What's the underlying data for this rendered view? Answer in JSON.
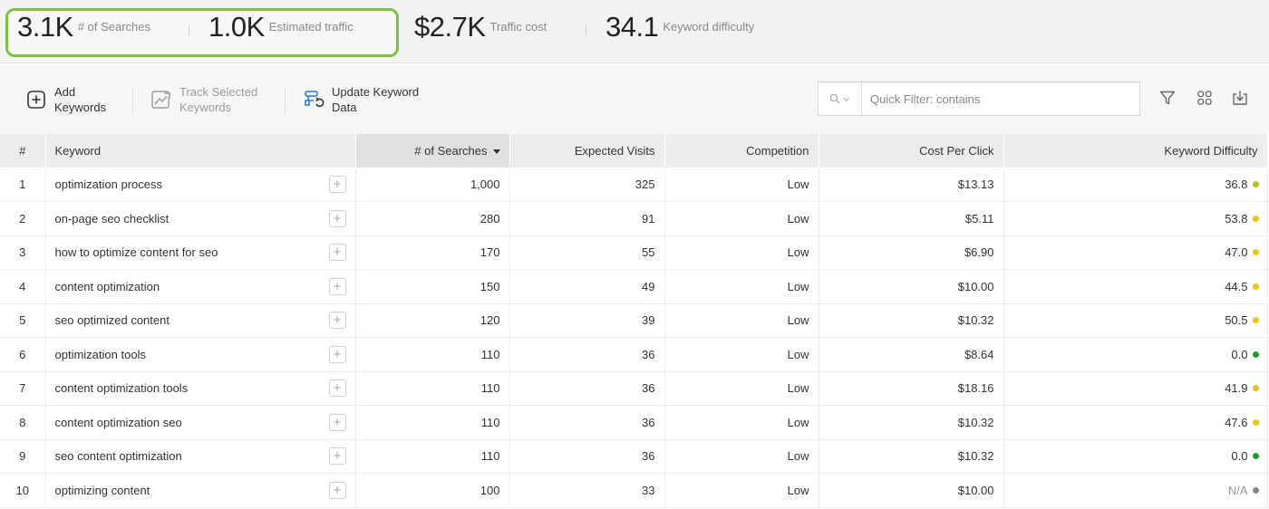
{
  "metrics": {
    "searches": {
      "value": "3.1K",
      "label": "# of Searches"
    },
    "traffic": {
      "value": "1.0K",
      "label": "Estimated traffic"
    },
    "cost": {
      "value": "$2.7K",
      "label": "Traffic cost"
    },
    "difficulty": {
      "value": "34.1",
      "label": "Keyword difficulty"
    }
  },
  "toolbar": {
    "add_keywords": "Add Keywords",
    "track_selected": "Track Selected Keywords",
    "update_data": "Update Keyword Data",
    "search_placeholder": "Quick Filter: contains",
    "search_value": ""
  },
  "table": {
    "headers": {
      "num": "#",
      "keyword": "Keyword",
      "searches": "# of Searches",
      "visits": "Expected Visits",
      "competition": "Competition",
      "cpc": "Cost Per Click",
      "kd": "Keyword Difficulty"
    },
    "rows": [
      {
        "num": "1",
        "keyword": "optimization process",
        "searches": "1,000",
        "visits": "325",
        "competition": "Low",
        "cpc": "$13.13",
        "kd": "36.8",
        "kd_color": "#b5c21a"
      },
      {
        "num": "2",
        "keyword": "on-page seo checklist",
        "searches": "280",
        "visits": "91",
        "competition": "Low",
        "cpc": "$5.11",
        "kd": "53.8",
        "kd_color": "#f0c419"
      },
      {
        "num": "3",
        "keyword": "how to optimize content for seo",
        "searches": "170",
        "visits": "55",
        "competition": "Low",
        "cpc": "$6.90",
        "kd": "47.0",
        "kd_color": "#f0c419"
      },
      {
        "num": "4",
        "keyword": "content optimization",
        "searches": "150",
        "visits": "49",
        "competition": "Low",
        "cpc": "$10.00",
        "kd": "44.5",
        "kd_color": "#f0c419"
      },
      {
        "num": "5",
        "keyword": "seo optimized content",
        "searches": "120",
        "visits": "39",
        "competition": "Low",
        "cpc": "$10.32",
        "kd": "50.5",
        "kd_color": "#f0c419"
      },
      {
        "num": "6",
        "keyword": "optimization tools",
        "searches": "110",
        "visits": "36",
        "competition": "Low",
        "cpc": "$8.64",
        "kd": "0.0",
        "kd_color": "#1e9e1e"
      },
      {
        "num": "7",
        "keyword": "content optimization tools",
        "searches": "110",
        "visits": "36",
        "competition": "Low",
        "cpc": "$18.16",
        "kd": "41.9",
        "kd_color": "#e4c51b"
      },
      {
        "num": "8",
        "keyword": "content optimization seo",
        "searches": "110",
        "visits": "36",
        "competition": "Low",
        "cpc": "$10.32",
        "kd": "47.6",
        "kd_color": "#f0c419"
      },
      {
        "num": "9",
        "keyword": "seo content optimization",
        "searches": "110",
        "visits": "36",
        "competition": "Low",
        "cpc": "$10.32",
        "kd": "0.0",
        "kd_color": "#1e9e1e"
      },
      {
        "num": "10",
        "keyword": "optimizing content",
        "searches": "100",
        "visits": "33",
        "competition": "Low",
        "cpc": "$10.00",
        "kd": "N/A",
        "kd_color": "#8a8a8a"
      }
    ]
  },
  "colors": {
    "highlight": "#7cc142",
    "update_icon": "#2a7bd4"
  }
}
